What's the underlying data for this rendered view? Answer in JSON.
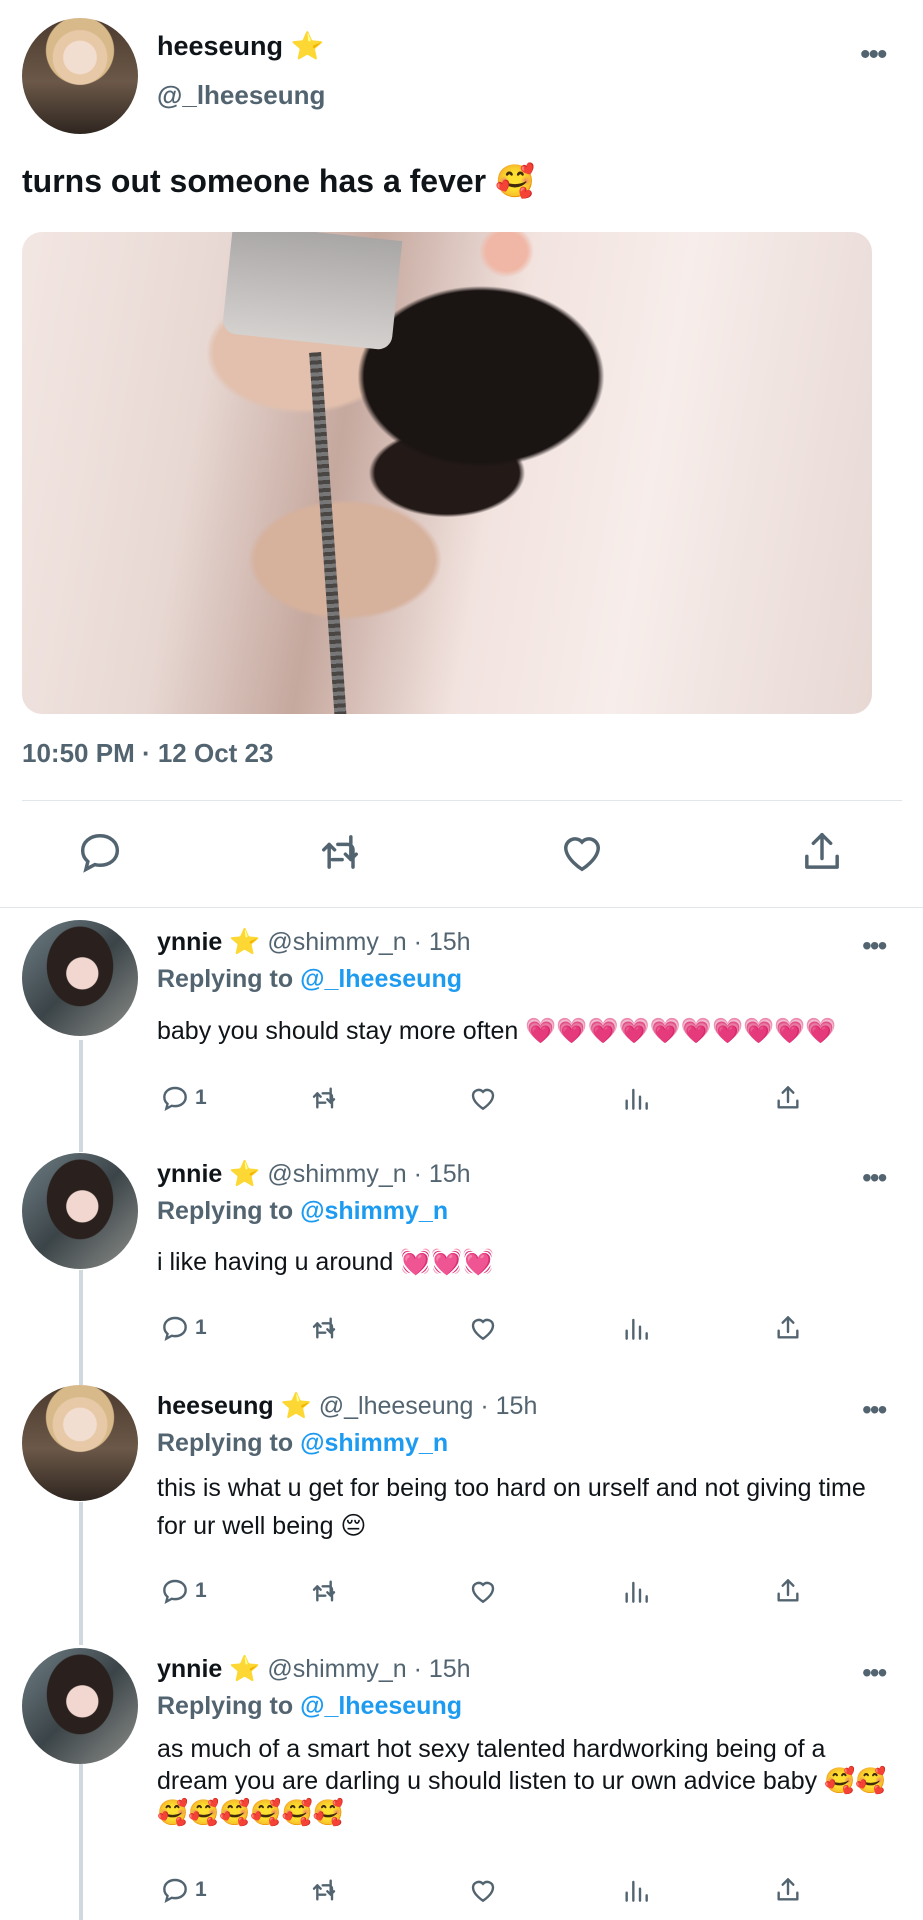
{
  "main_tweet": {
    "author_name": "heeseung",
    "verified_star": "⭐",
    "handle": "@_lheeseung",
    "more": "•••",
    "text": "turns out someone has a fever 🥰",
    "timestamp": "10:50 PM · 12 Oct 23",
    "icons": [
      "reply-icon",
      "retweet-icon",
      "like-icon",
      "share-icon"
    ]
  },
  "replies": [
    {
      "author_name": "ynnie",
      "star": "⭐",
      "handle_time": "@shimmy_n · 15h",
      "replying_label": "Replying to",
      "replying_to": "@_lheeseung",
      "text": "baby you should stay more often 💗💗💗💗💗💗💗💗💗💗",
      "reply_count": "1",
      "more": "•••"
    },
    {
      "author_name": "ynnie",
      "star": "⭐",
      "handle_time": "@shimmy_n · 15h",
      "replying_label": "Replying to",
      "replying_to": "@shimmy_n",
      "text": "i like having u around 💓💓💓",
      "reply_count": "1",
      "more": "•••"
    },
    {
      "author_name": "heeseung",
      "star": "⭐",
      "handle_time": "@_lheeseung · 15h",
      "replying_label": "Replying to",
      "replying_to": "@shimmy_n",
      "text": "this is what u get for being too hard on urself and not giving time for ur well being 😔",
      "reply_count": "1",
      "more": "•••"
    },
    {
      "author_name": "ynnie",
      "star": "⭐",
      "handle_time": "@shimmy_n · 15h",
      "replying_label": "Replying to",
      "replying_to": "@_lheeseung",
      "text": "as much of a smart hot sexy talented hardworking being of a dream you are darling u should listen to ur own advice baby 🥰🥰🥰🥰🥰🥰🥰🥰",
      "reply_count": "1",
      "more": "•••"
    }
  ],
  "colors": {
    "text": "#0f1419",
    "secondary": "#536471",
    "link": "#1d9bf0",
    "divider": "#e1e6ea",
    "star": "#f7c948"
  }
}
